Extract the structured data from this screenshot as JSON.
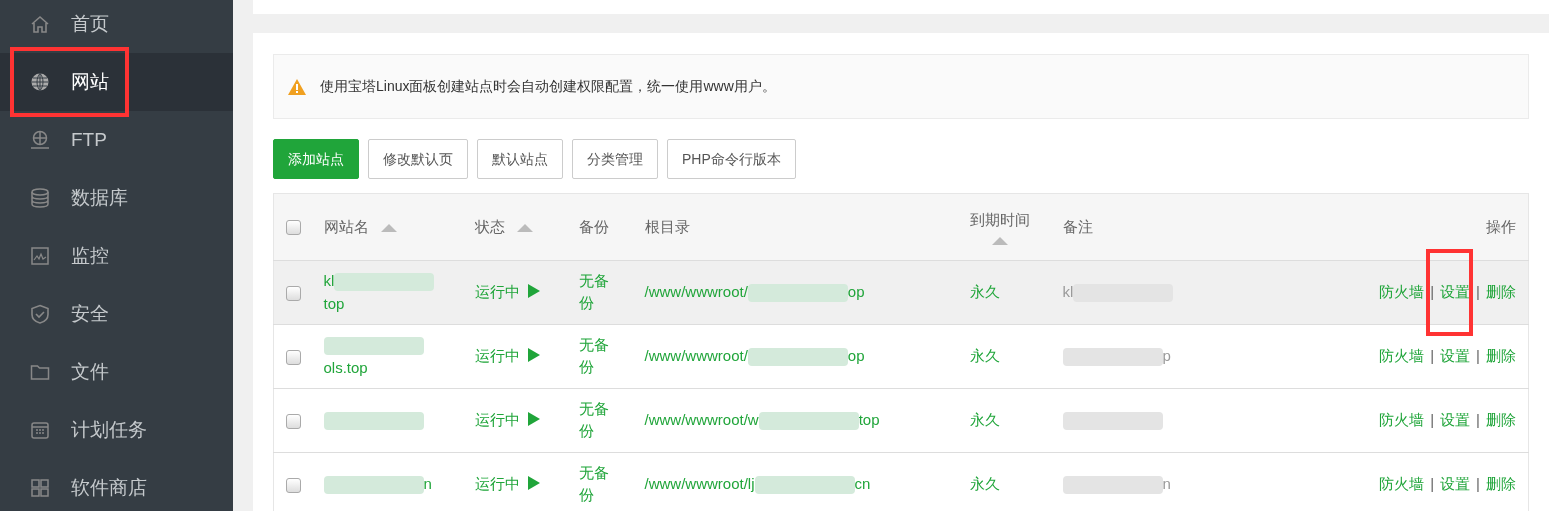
{
  "sidebar": {
    "items": [
      {
        "label": "首页",
        "selected": false,
        "highlighted": false
      },
      {
        "label": "网站",
        "selected": true,
        "highlighted": true
      },
      {
        "label": "FTP",
        "selected": false,
        "highlighted": false
      },
      {
        "label": "数据库",
        "selected": false,
        "highlighted": false
      },
      {
        "label": "监控",
        "selected": false,
        "highlighted": false
      },
      {
        "label": "安全",
        "selected": false,
        "highlighted": false
      },
      {
        "label": "文件",
        "selected": false,
        "highlighted": false
      },
      {
        "label": "计划任务",
        "selected": false,
        "highlighted": false
      },
      {
        "label": "软件商店",
        "selected": false,
        "highlighted": false
      }
    ]
  },
  "notice": {
    "text": "使用宝塔Linux面板创建站点时会自动创建权限配置，统一使用www用户。"
  },
  "toolbar": {
    "buttons": [
      {
        "label": "添加站点",
        "kind": "primary"
      },
      {
        "label": "修改默认页",
        "kind": "default"
      },
      {
        "label": "默认站点",
        "kind": "default"
      },
      {
        "label": "分类管理",
        "kind": "default"
      },
      {
        "label": "PHP命令行版本",
        "kind": "default"
      }
    ]
  },
  "table": {
    "select_all": {
      "checked": false
    },
    "columns": [
      {
        "label": "网站名",
        "sortable": true
      },
      {
        "label": "状态",
        "sortable": true
      },
      {
        "label": "备份",
        "sortable": false
      },
      {
        "label": "根目录",
        "sortable": false
      },
      {
        "label": "到期时间",
        "sortable": true
      },
      {
        "label": "备注",
        "sortable": false
      },
      {
        "label": "操作",
        "sortable": false
      }
    ],
    "rows": [
      {
        "checked": false,
        "hovered": true,
        "name": {
          "before": "kl",
          "after": "top"
        },
        "status": "运行中",
        "backup": "无备份",
        "path": {
          "before": "/www/wwwroot/",
          "after": "op"
        },
        "expiry": "永久",
        "remark": {
          "before": "kl"
        },
        "actions": [
          {
            "kind": "link",
            "label": "防火墙",
            "highlighted": false
          },
          {
            "kind": "separator",
            "label": "|"
          },
          {
            "kind": "link",
            "label": "设置",
            "highlighted": true
          },
          {
            "kind": "separator",
            "label": "|"
          },
          {
            "kind": "link",
            "label": "删除",
            "highlighted": false
          }
        ]
      },
      {
        "checked": false,
        "hovered": false,
        "name": {
          "after": "ols.top"
        },
        "status": "运行中",
        "backup": "无备份",
        "path": {
          "before": "/www/wwwroot/",
          "after": "op"
        },
        "expiry": "永久",
        "remark": {
          "after": "p"
        },
        "actions": [
          {
            "kind": "link",
            "label": "防火墙",
            "highlighted": false
          },
          {
            "kind": "separator",
            "label": "|"
          },
          {
            "kind": "link",
            "label": "设置",
            "highlighted": false
          },
          {
            "kind": "separator",
            "label": "|"
          },
          {
            "kind": "link",
            "label": "删除",
            "highlighted": false
          }
        ]
      },
      {
        "checked": false,
        "hovered": false,
        "name": {},
        "status": "运行中",
        "backup": "无备份",
        "path": {
          "before": "/www/wwwroot/w",
          "after": "top"
        },
        "expiry": "永久",
        "remark": {},
        "actions": [
          {
            "kind": "link",
            "label": "防火墙",
            "highlighted": false
          },
          {
            "kind": "separator",
            "label": "|"
          },
          {
            "kind": "link",
            "label": "设置",
            "highlighted": false
          },
          {
            "kind": "separator",
            "label": "|"
          },
          {
            "kind": "link",
            "label": "删除",
            "highlighted": false
          }
        ]
      },
      {
        "checked": false,
        "hovered": false,
        "name": {
          "after": "n"
        },
        "status": "运行中",
        "backup": "无备份",
        "path": {
          "before": "/www/wwwroot/lj",
          "after": "cn"
        },
        "expiry": "永久",
        "remark": {
          "after": "n"
        },
        "actions": [
          {
            "kind": "link",
            "label": "防火墙",
            "highlighted": false
          },
          {
            "kind": "separator",
            "label": "|"
          },
          {
            "kind": "link",
            "label": "设置",
            "highlighted": false
          },
          {
            "kind": "separator",
            "label": "|"
          },
          {
            "kind": "link",
            "label": "删除",
            "highlighted": false
          }
        ]
      }
    ]
  }
}
